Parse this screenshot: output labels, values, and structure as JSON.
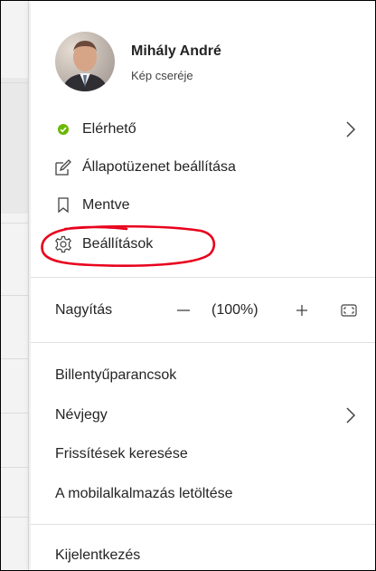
{
  "profile": {
    "name": "Mihály André",
    "change_photo": "Kép cseréje"
  },
  "status": {
    "label": "Elérhető",
    "color": "#6bb700"
  },
  "menu": {
    "status_message": "Állapotüzenet beállítása",
    "saved": "Mentve",
    "settings": "Beállítások",
    "zoom_label": "Nagyítás",
    "zoom_minus": "−",
    "zoom_value": "(100%)",
    "zoom_plus": "+",
    "shortcuts": "Billentyűparancsok",
    "about": "Névjegy",
    "check_updates": "Frissítések keresése",
    "download_mobile": "A mobilalkalmazás letöltése",
    "sign_out": "Kijelentkezés"
  },
  "annotation": {
    "color": "#e8001c"
  }
}
